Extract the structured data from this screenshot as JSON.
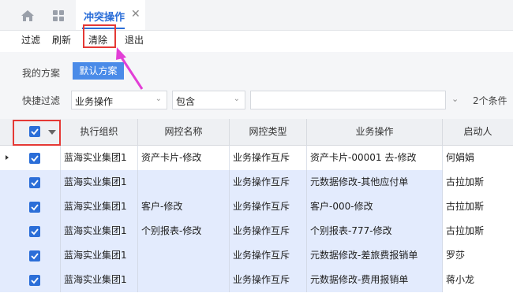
{
  "tab": {
    "label": "冲突操作",
    "close": "✕"
  },
  "icons": {
    "home": "home-icon",
    "apps": "grid-icon"
  },
  "toolbar": {
    "filter": "过滤",
    "refresh": "刷新",
    "clear": "清除",
    "exit": "退出"
  },
  "filter": {
    "plan_label": "我的方案",
    "plan_button": "默认方案",
    "quick_label": "快捷过滤",
    "field_value": "业务操作",
    "operator_value": "包含",
    "value": "",
    "condition_count": "2个条件"
  },
  "table": {
    "columns": [
      "执行组织",
      "网控名称",
      "网控类型",
      "业务操作",
      "启动人"
    ],
    "rows": [
      [
        "蓝海实业集团1",
        "资产卡片-修改",
        "业务操作互斥",
        "资产卡片-00001 去-修改",
        "何娟娟"
      ],
      [
        "蓝海实业集团1",
        "",
        "业务操作互斥",
        "元数据修改-其他应付单",
        "古拉加斯"
      ],
      [
        "蓝海实业集团1",
        "客户-修改",
        "业务操作互斥",
        "客户-000-修改",
        "古拉加斯"
      ],
      [
        "蓝海实业集团1",
        "个别报表-修改",
        "业务操作互斥",
        "个别报表-777-修改",
        "古拉加斯"
      ],
      [
        "蓝海实业集团1",
        "",
        "业务操作互斥",
        "元数据修改-差旅费报销单",
        "罗莎"
      ],
      [
        "蓝海实业集团1",
        "",
        "业务操作互斥",
        "元数据修改-费用报销单",
        "蒋小龙"
      ]
    ]
  },
  "colors": {
    "accent": "#2b6ed8",
    "highlight": "#e53935",
    "arrow": "#e23fd6",
    "row_selected": "#e3ebfd"
  }
}
